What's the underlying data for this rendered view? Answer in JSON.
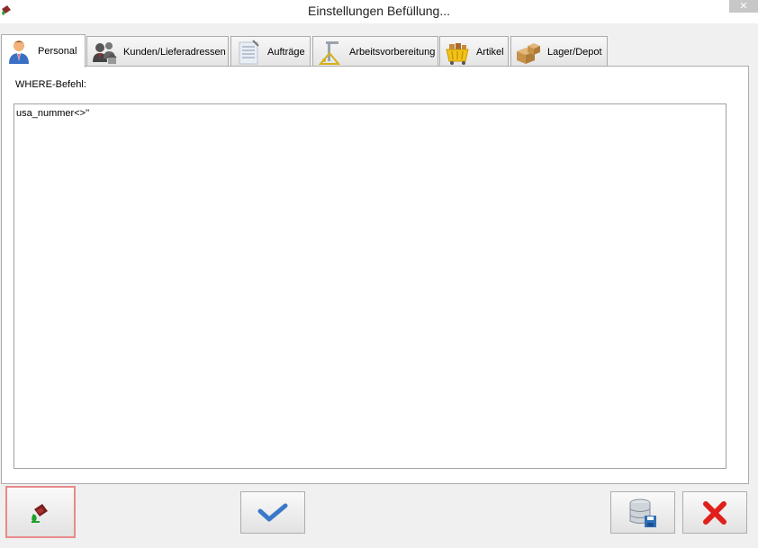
{
  "window": {
    "title": "Einstellungen Befüllung...",
    "close_glyph": "✕"
  },
  "tabs": [
    {
      "label": "Personal",
      "icon": "person-icon",
      "active": true
    },
    {
      "label": "Kunden/Lieferadressen",
      "icon": "customers-icon",
      "active": false
    },
    {
      "label": "Aufträge",
      "icon": "orders-icon",
      "active": false
    },
    {
      "label": "Arbeitsvorbereitung",
      "icon": "work-preparation-icon",
      "active": false
    },
    {
      "label": "Artikel",
      "icon": "shopping-basket-icon",
      "active": false
    },
    {
      "label": "Lager/Depot",
      "icon": "boxes-icon",
      "active": false
    }
  ],
  "panel": {
    "where_label": "WHERE-Befehl:",
    "where_value": "usa_nummer<>''"
  },
  "buttons": {
    "fill": {
      "icon": "paint-bucket-icon"
    },
    "confirm": {
      "icon": "checkmark-icon"
    },
    "save_db": {
      "icon": "database-save-icon"
    },
    "cancel": {
      "icon": "red-x-icon"
    }
  },
  "colors": {
    "highlight_border": "#e88a8a",
    "check_blue": "#3a78c9",
    "cancel_red": "#e0201c"
  }
}
